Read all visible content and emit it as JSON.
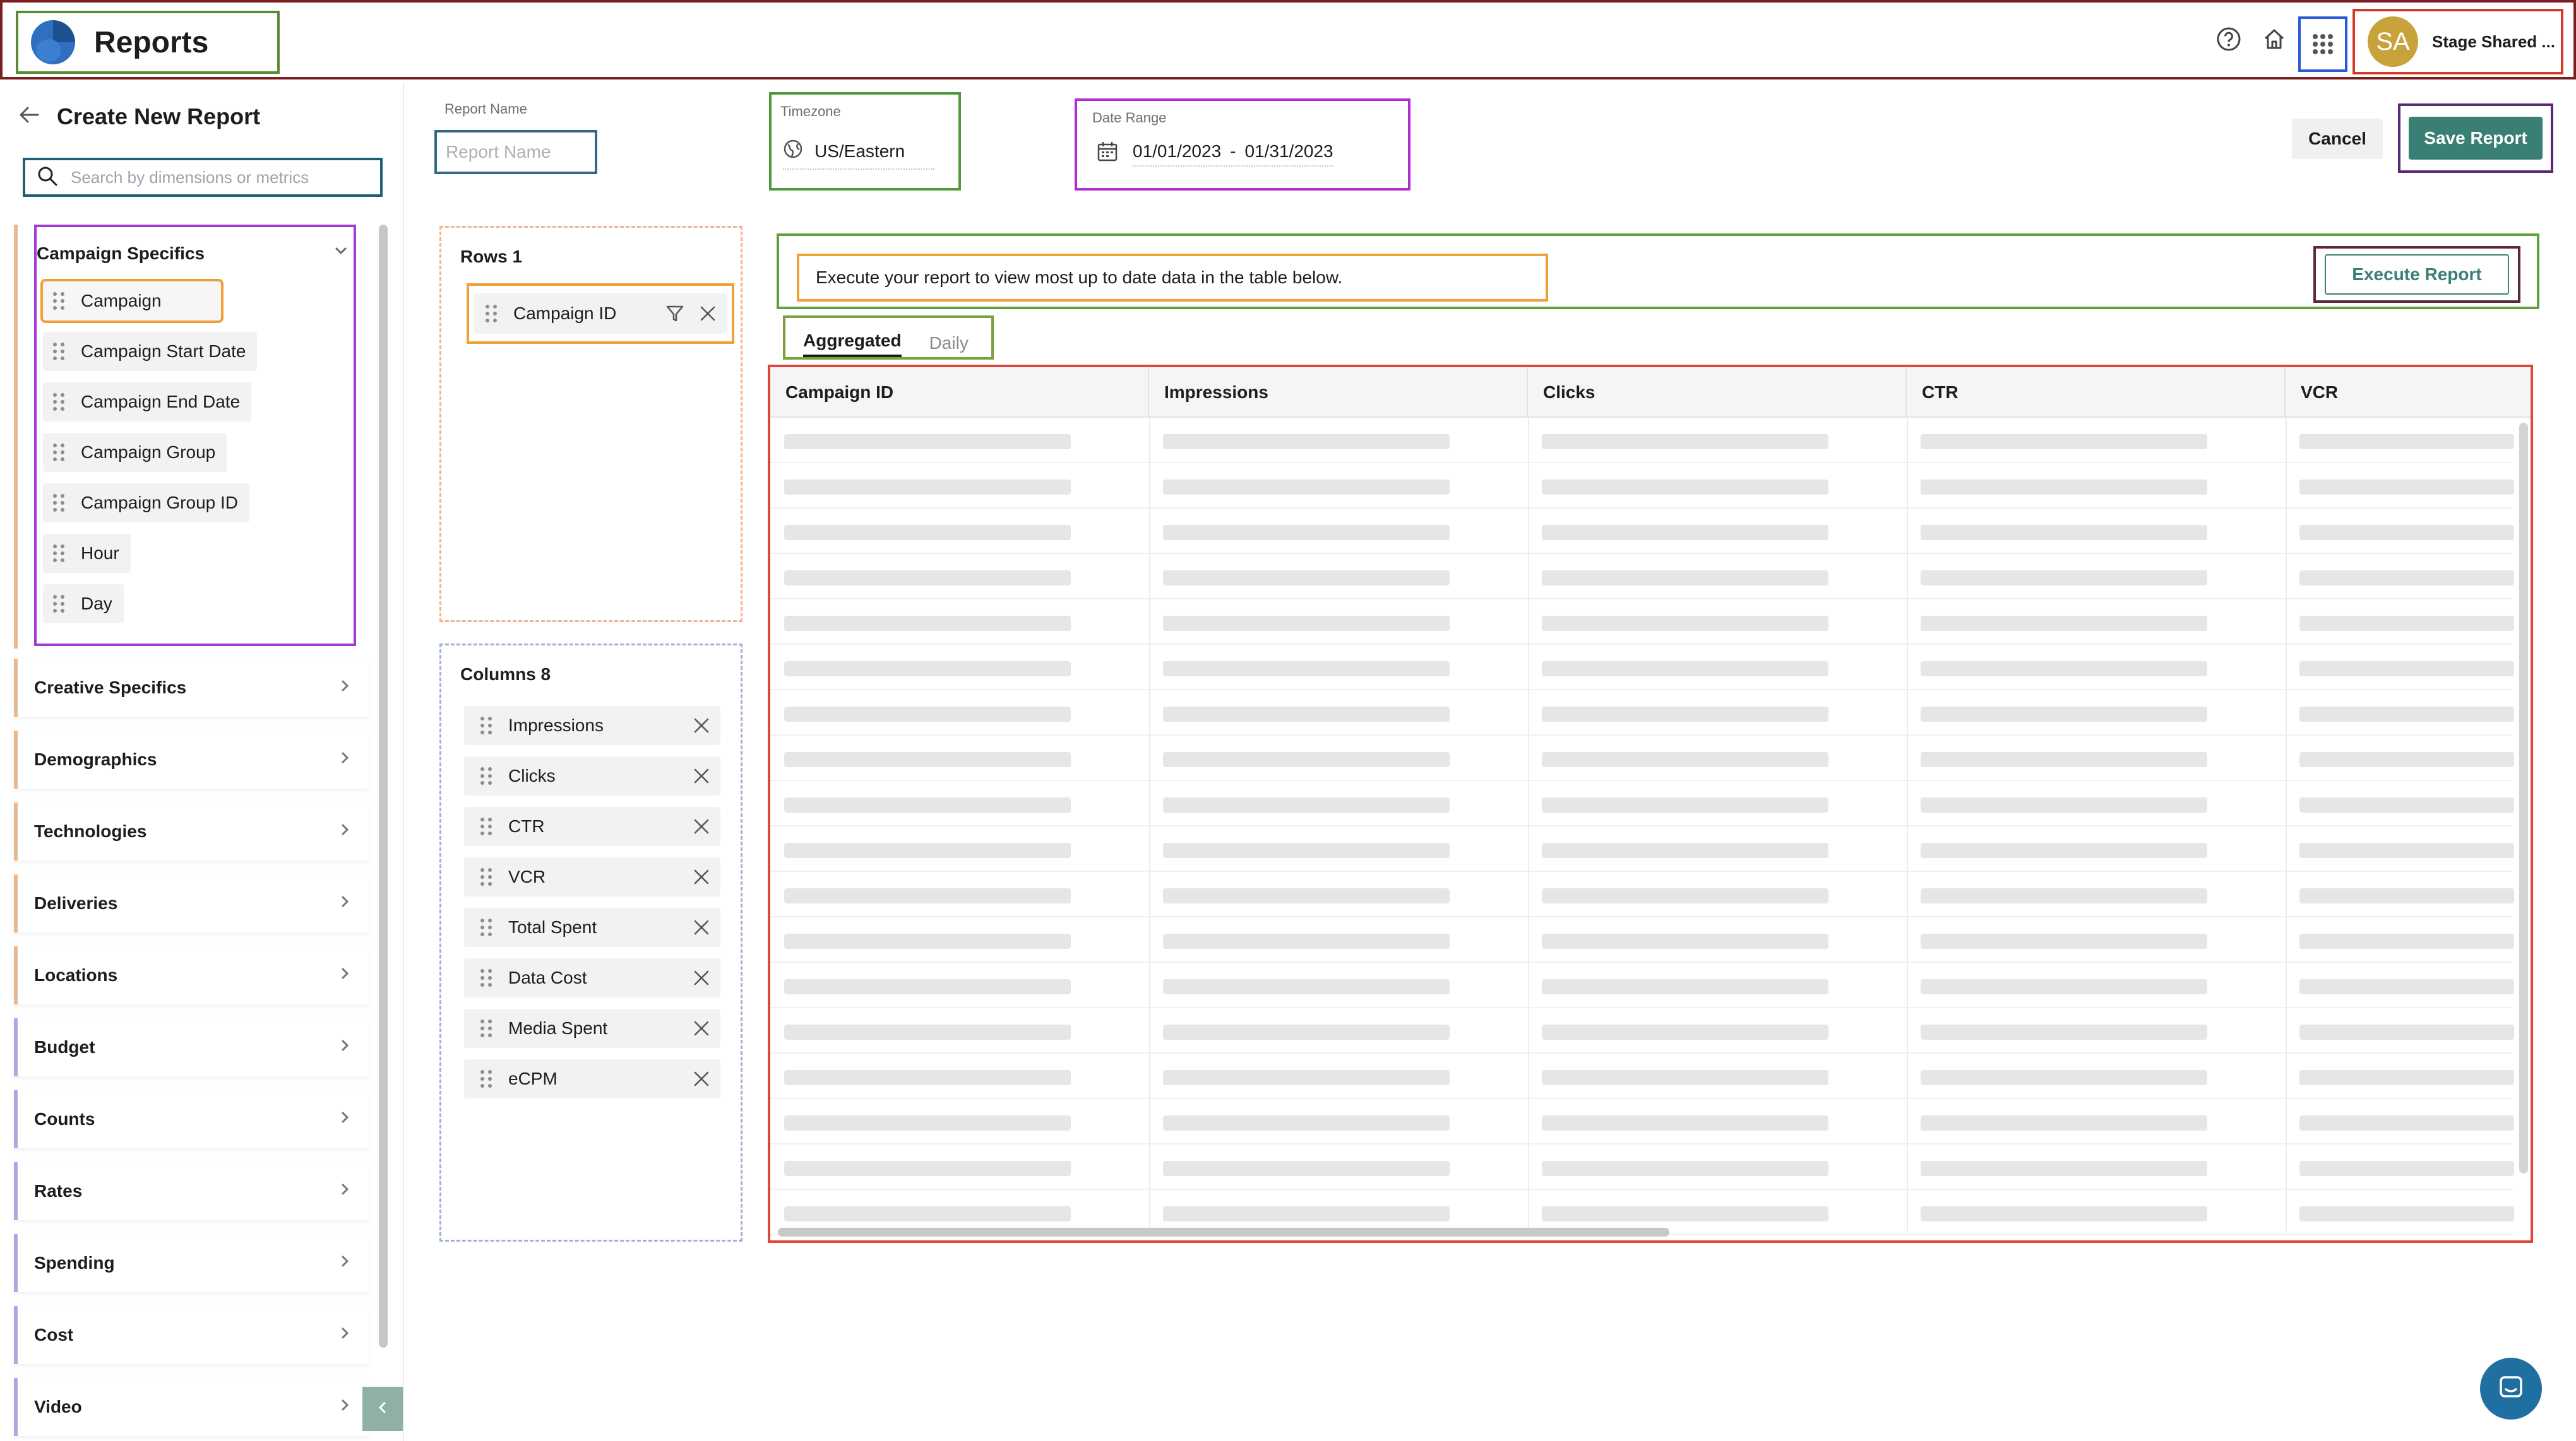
{
  "header": {
    "app_title": "Reports",
    "user_initials": "SA",
    "user_name": "Stage Shared ..."
  },
  "sidebar": {
    "back_title": "Create New Report",
    "search_placeholder": "Search by dimensions or metrics",
    "open_group": {
      "label": "Campaign Specifics",
      "items": [
        "Campaign",
        "Campaign Start Date",
        "Campaign End Date",
        "Campaign Group",
        "Campaign Group ID",
        "Hour",
        "Day"
      ]
    },
    "categories": [
      "Creative Specifics",
      "Demographics",
      "Technologies",
      "Deliveries",
      "Locations",
      "Budget",
      "Counts",
      "Rates",
      "Spending",
      "Cost",
      "Video"
    ]
  },
  "form": {
    "report_name_label": "Report Name",
    "report_name_placeholder": "Report Name",
    "timezone_label": "Timezone",
    "timezone_value": "US/Eastern",
    "date_range_label": "Date Range",
    "date_start": "01/01/2023",
    "date_sep": "-",
    "date_end": "01/31/2023",
    "cancel_label": "Cancel",
    "save_label": "Save Report"
  },
  "rows_panel": {
    "title": "Rows 1",
    "items": [
      "Campaign ID"
    ]
  },
  "columns_panel": {
    "title": "Columns 8",
    "items": [
      "Impressions",
      "Clicks",
      "CTR",
      "VCR",
      "Total Spent",
      "Data Cost",
      "Media Spent",
      "eCPM"
    ]
  },
  "execute": {
    "message": "Execute your report to view most up to date data in the table below.",
    "button_label": "Execute Report"
  },
  "tabs": [
    {
      "label": "Aggregated",
      "active": true
    },
    {
      "label": "Daily",
      "active": false
    }
  ],
  "table": {
    "columns": [
      "Campaign ID",
      "Impressions",
      "Clicks",
      "CTR",
      "VCR"
    ],
    "loading_rows": 18
  },
  "colors": {
    "accent": "#3a7f73",
    "brand_blue": "#2f6fbf",
    "avatar": "#c8a23a"
  },
  "icons": {
    "help": "help-circle-icon",
    "home": "home-icon",
    "apps": "apps-grid-icon",
    "back": "arrow-left-icon",
    "search": "search-icon",
    "globe": "globe-icon",
    "calendar": "calendar-icon",
    "filter": "filter-icon",
    "close": "close-icon",
    "chat": "chat-icon"
  }
}
